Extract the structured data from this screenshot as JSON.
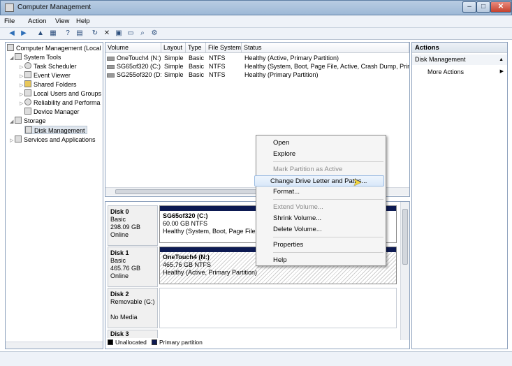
{
  "window": {
    "title": "Computer Management"
  },
  "menus": [
    "File",
    "Action",
    "View",
    "Help"
  ],
  "tree": {
    "root": "Computer Management (Local",
    "system_tools": "System Tools",
    "task_scheduler": "Task Scheduler",
    "event_viewer": "Event Viewer",
    "shared_folders": "Shared Folders",
    "local_users": "Local Users and Groups",
    "reliability": "Reliability and Performa",
    "device_manager": "Device Manager",
    "storage": "Storage",
    "disk_management": "Disk Management",
    "services": "Services and Applications"
  },
  "volume_table": {
    "headers": [
      "Volume",
      "Layout",
      "Type",
      "File System",
      "Status"
    ],
    "rows": [
      [
        "OneTouch4 (N:)",
        "Simple",
        "Basic",
        "NTFS",
        "Healthy (Active, Primary Partition)"
      ],
      [
        "SG65of320 (C:)",
        "Simple",
        "Basic",
        "NTFS",
        "Healthy (System, Boot, Page File, Active, Crash Dump, Primar"
      ],
      [
        "SG255of320 (D:)",
        "Simple",
        "Basic",
        "NTFS",
        "Healthy (Primary Partition)"
      ]
    ]
  },
  "disks": {
    "disk0": {
      "name": "Disk 0",
      "type": "Basic",
      "size": "298.09 GB",
      "state": "Online",
      "part_name": "SG65of320  (C:)",
      "part_size": "60.00 GB NTFS",
      "part_status": "Healthy (System, Boot, Page File, A"
    },
    "disk1": {
      "name": "Disk 1",
      "type": "Basic",
      "size": "465.76 GB",
      "state": "Online",
      "part_name": "OneTouch4  (N:)",
      "part_size": "465.76 GB NTFS",
      "part_status": "Healthy (Active, Primary Partition)"
    },
    "disk2": {
      "name": "Disk 2",
      "type": "Removable (G:)",
      "state": "No Media"
    },
    "disk3": {
      "name": "Disk 3"
    }
  },
  "legend": {
    "unallocated": "Unallocated",
    "primary": "Primary partition"
  },
  "actions": {
    "header": "Actions",
    "section": "Disk Management",
    "more": "More Actions"
  },
  "context_menu": {
    "open": "Open",
    "explore": "Explore",
    "mark_active": "Mark Partition as Active",
    "change_letter": "Change Drive Letter and Paths...",
    "format": "Format...",
    "extend": "Extend Volume...",
    "shrink": "Shrink Volume...",
    "delete": "Delete Volume...",
    "properties": "Properties",
    "help": "Help"
  },
  "colors": {
    "primary_partition": "#0d1a52",
    "unallocated": "#000000"
  }
}
